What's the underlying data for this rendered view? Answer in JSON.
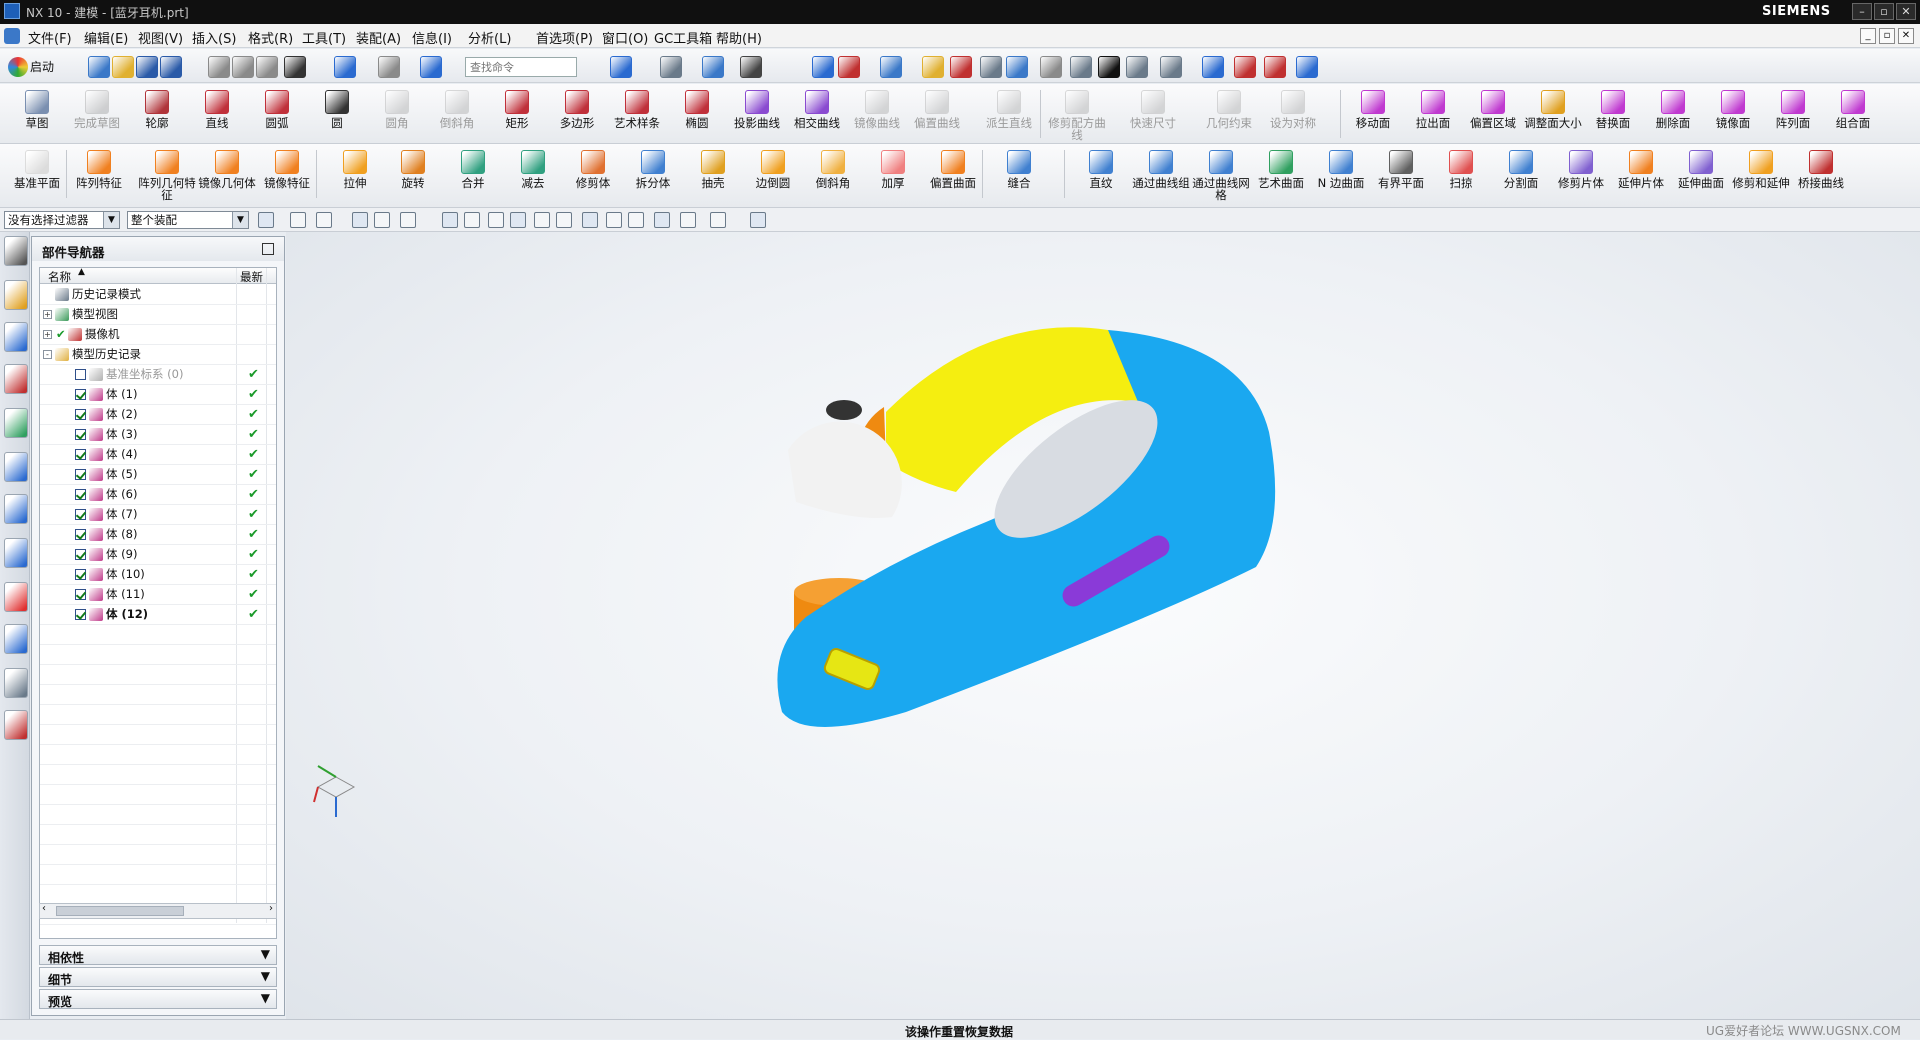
{
  "app": {
    "title": "NX 10 - 建模 - [蓝牙耳机.prt]",
    "brand": "SIEMENS"
  },
  "menu": [
    "文件(F)",
    "编辑(E)",
    "视图(V)",
    "插入(S)",
    "格式(R)",
    "工具(T)",
    "装配(A)",
    "信息(I)",
    "分析(L)",
    "首选项(P)",
    "窗口(O)",
    "GC工具箱",
    "帮助(H)"
  ],
  "std": {
    "start": "启动",
    "search_placeholder": "查找命令"
  },
  "ribbon1": [
    {
      "label": "草图",
      "color": "#7a8fb0",
      "dis": false
    },
    {
      "label": "完成草图",
      "color": "#8a8a8a",
      "dis": true
    },
    {
      "label": "轮廓",
      "color": "#b0343a",
      "dis": false
    },
    {
      "label": "直线",
      "color": "#c0303a",
      "dis": false
    },
    {
      "label": "圆弧",
      "color": "#c0303a",
      "dis": false
    },
    {
      "label": "圆",
      "color": "#333333",
      "dis": false
    },
    {
      "label": "圆角",
      "color": "#999999",
      "dis": true
    },
    {
      "label": "倒斜角",
      "color": "#999999",
      "dis": true
    },
    {
      "label": "矩形",
      "color": "#c0303a",
      "dis": false
    },
    {
      "label": "多边形",
      "color": "#c0303a",
      "dis": false
    },
    {
      "label": "艺术样条",
      "color": "#c0303a",
      "dis": false
    },
    {
      "label": "椭圆",
      "color": "#c0303a",
      "dis": false
    },
    {
      "label": "投影曲线",
      "color": "#8a4ad0",
      "dis": false
    },
    {
      "label": "相交曲线",
      "color": "#8a4ad0",
      "dis": false
    },
    {
      "label": "镜像曲线",
      "color": "#999999",
      "dis": true
    },
    {
      "label": "偏置曲线",
      "color": "#999999",
      "dis": true
    },
    {
      "label": "派生直线",
      "color": "#999999",
      "dis": true
    },
    {
      "label": "修剪配方曲线",
      "color": "#999999",
      "dis": true
    },
    {
      "label": "快速尺寸",
      "color": "#999999",
      "dis": true
    },
    {
      "label": "几何约束",
      "color": "#999999",
      "dis": true
    },
    {
      "label": "设为对称",
      "color": "#999999",
      "dis": true
    },
    {
      "label": "移动面",
      "color": "#c03ad0",
      "dis": false
    },
    {
      "label": "拉出面",
      "color": "#c03ad0",
      "dis": false
    },
    {
      "label": "偏置区域",
      "color": "#c03ad0",
      "dis": false
    },
    {
      "label": "调整面大小",
      "color": "#e0a020",
      "dis": false
    },
    {
      "label": "替换面",
      "color": "#c03ad0",
      "dis": false
    },
    {
      "label": "删除面",
      "color": "#c03ad0",
      "dis": false
    },
    {
      "label": "镜像面",
      "color": "#c03ad0",
      "dis": false
    },
    {
      "label": "阵列面",
      "color": "#c03ad0",
      "dis": false
    },
    {
      "label": "组合面",
      "color": "#c03ad0",
      "dis": false
    }
  ],
  "ribbon2": [
    {
      "label": "基准平面",
      "color": "#dcdcdc"
    },
    {
      "label": "阵列特征",
      "color": "#f08020"
    },
    {
      "label": "阵列几何特征",
      "color": "#f08020"
    },
    {
      "label": "镜像几何体",
      "color": "#f08020"
    },
    {
      "label": "镜像特征",
      "color": "#f08020"
    },
    {
      "label": "拉伸",
      "color": "#f0a020"
    },
    {
      "label": "旋转",
      "color": "#e08020"
    },
    {
      "label": "合并",
      "color": "#30a080"
    },
    {
      "label": "减去",
      "color": "#30a080"
    },
    {
      "label": "修剪体",
      "color": "#e07030"
    },
    {
      "label": "拆分体",
      "color": "#4080d0"
    },
    {
      "label": "抽壳",
      "color": "#e0a020"
    },
    {
      "label": "边倒圆",
      "color": "#f0a020"
    },
    {
      "label": "倒斜角",
      "color": "#f0b040"
    },
    {
      "label": "加厚",
      "color": "#f08080"
    },
    {
      "label": "偏置曲面",
      "color": "#f08020"
    },
    {
      "label": "缝合",
      "color": "#4080d0"
    },
    {
      "label": "直纹",
      "color": "#4080d0"
    },
    {
      "label": "通过曲线组",
      "color": "#4080d0"
    },
    {
      "label": "通过曲线网格",
      "color": "#4080d0"
    },
    {
      "label": "艺术曲面",
      "color": "#30a060"
    },
    {
      "label": "N 边曲面",
      "color": "#4080d0"
    },
    {
      "label": "有界平面",
      "color": "#606060"
    },
    {
      "label": "扫掠",
      "color": "#e05050"
    },
    {
      "label": "分割面",
      "color": "#4080d0"
    },
    {
      "label": "修剪片体",
      "color": "#8060d0"
    },
    {
      "label": "延伸片体",
      "color": "#f08020"
    },
    {
      "label": "延伸曲面",
      "color": "#8060d0"
    },
    {
      "label": "修剪和延伸",
      "color": "#f0a020"
    },
    {
      "label": "桥接曲线",
      "color": "#c03030"
    }
  ],
  "selbar": {
    "filter": "没有选择过滤器",
    "scope": "整个装配"
  },
  "navigator": {
    "title": "部件导航器",
    "col_name": "名称",
    "col_latest": "最新",
    "rows": [
      {
        "label": "历史记录模式",
        "level": 0,
        "exp": "",
        "cb": "",
        "icon": "#6a7a8a",
        "ok": ""
      },
      {
        "label": "模型视图",
        "level": 0,
        "exp": "+",
        "cb": "",
        "icon": "#3a9a5a",
        "ok": ""
      },
      {
        "label": "摄像机",
        "level": 0,
        "exp": "+",
        "cb": "check",
        "icon": "#c03030",
        "ok": ""
      },
      {
        "label": "模型历史记录",
        "level": 0,
        "exp": "-",
        "cb": "",
        "icon": "#e0b040",
        "ok": ""
      },
      {
        "label": "基准坐标系 (0)",
        "level": 1,
        "exp": "",
        "cb": "off",
        "icon": "#b0b0b0",
        "ok": "✔",
        "grey": true
      },
      {
        "label": "体 (1)",
        "level": 1,
        "exp": "",
        "cb": "on",
        "icon": "#c03a8a",
        "ok": "✔"
      },
      {
        "label": "体 (2)",
        "level": 1,
        "exp": "",
        "cb": "on",
        "icon": "#c03a8a",
        "ok": "✔"
      },
      {
        "label": "体 (3)",
        "level": 1,
        "exp": "",
        "cb": "on",
        "icon": "#c03a8a",
        "ok": "✔"
      },
      {
        "label": "体 (4)",
        "level": 1,
        "exp": "",
        "cb": "on",
        "icon": "#c03a8a",
        "ok": "✔"
      },
      {
        "label": "体 (5)",
        "level": 1,
        "exp": "",
        "cb": "on",
        "icon": "#c03a8a",
        "ok": "✔"
      },
      {
        "label": "体 (6)",
        "level": 1,
        "exp": "",
        "cb": "on",
        "icon": "#c03a8a",
        "ok": "✔"
      },
      {
        "label": "体 (7)",
        "level": 1,
        "exp": "",
        "cb": "on",
        "icon": "#c03a8a",
        "ok": "✔"
      },
      {
        "label": "体 (8)",
        "level": 1,
        "exp": "",
        "cb": "on",
        "icon": "#c03a8a",
        "ok": "✔"
      },
      {
        "label": "体 (9)",
        "level": 1,
        "exp": "",
        "cb": "on",
        "icon": "#c03a8a",
        "ok": "✔"
      },
      {
        "label": "体 (10)",
        "level": 1,
        "exp": "",
        "cb": "on",
        "icon": "#c03a8a",
        "ok": "✔"
      },
      {
        "label": "体 (11)",
        "level": 1,
        "exp": "",
        "cb": "on",
        "icon": "#c03a8a",
        "ok": "✔"
      },
      {
        "label": "体 (12)",
        "level": 1,
        "exp": "",
        "cb": "on",
        "icon": "#c03a8a",
        "ok": "✔",
        "bold": true
      }
    ],
    "panels": [
      "相依性",
      "细节",
      "预览"
    ]
  },
  "model": {
    "blue": "#1aa8f0",
    "yellow": "#f5ee10",
    "orange": "#ef8a10",
    "white": "#f2f2f2",
    "purple": "#8a3ad8"
  },
  "status": {
    "message": "该操作重置恢复数据",
    "watermark": "UG爱好者论坛 WWW.UGSNX.COM"
  }
}
